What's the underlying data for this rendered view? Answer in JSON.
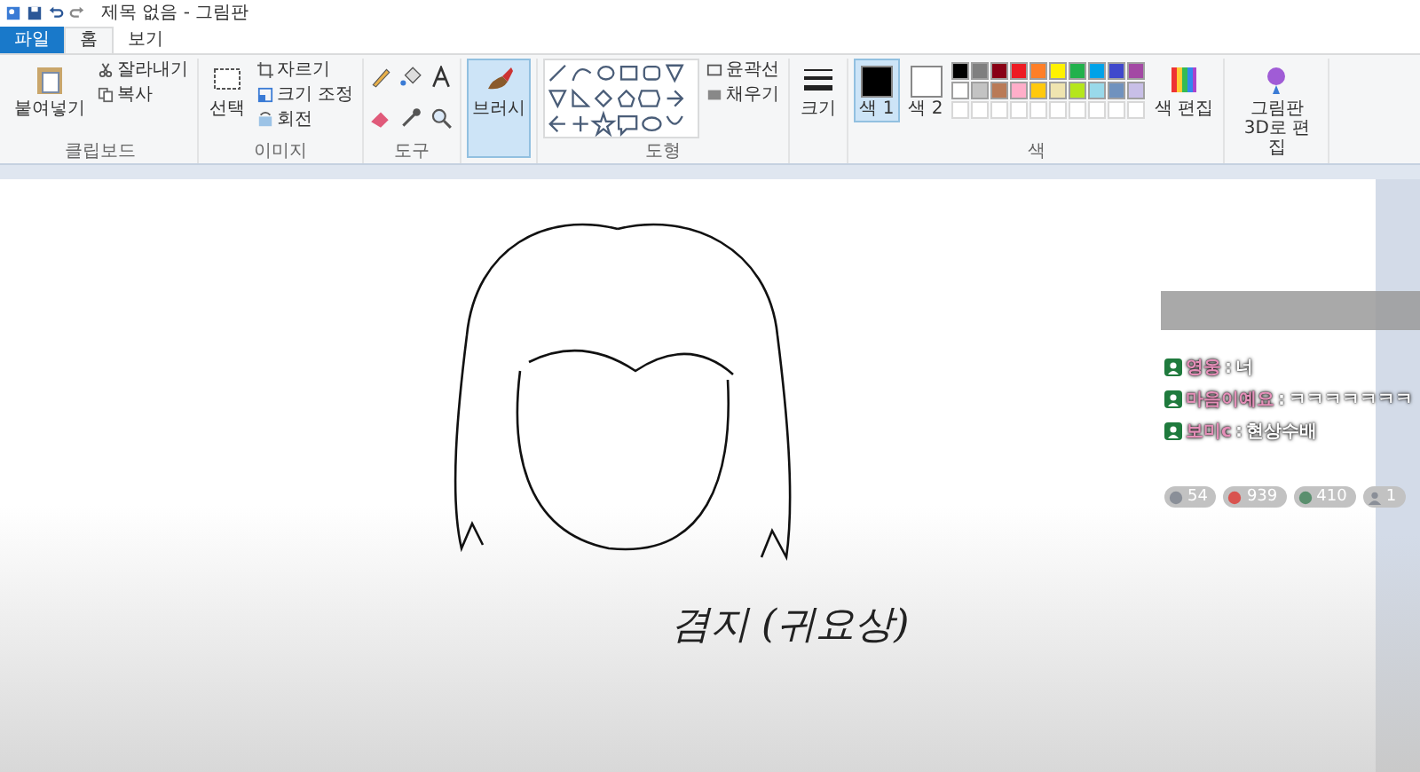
{
  "window": {
    "title": "제목 없음 - 그림판"
  },
  "tabs": [
    {
      "label": "파일",
      "kind": "file",
      "selected": false
    },
    {
      "label": "홈",
      "kind": "tab",
      "selected": true
    },
    {
      "label": "보기",
      "kind": "tab",
      "selected": false
    }
  ],
  "ribbon": {
    "clipboard": {
      "paste": "붙여넣기",
      "cut": "잘라내기",
      "copy": "복사",
      "group": "클립보드"
    },
    "image": {
      "select": "선택",
      "crop": "자르기",
      "resize": "크기 조정",
      "rotate": "회전",
      "group": "이미지"
    },
    "tools": {
      "group": "도구"
    },
    "brushes": {
      "label": "브러시"
    },
    "shapes": {
      "outline": "윤곽선",
      "fill": "채우기",
      "group": "도형"
    },
    "size": {
      "label": "크기"
    },
    "colors": {
      "group": "색",
      "primary": {
        "label": "색 1",
        "color": "#000000",
        "selected": true
      },
      "secondary": {
        "label": "색 2",
        "color": "#ffffff",
        "selected": false
      },
      "swatches": [
        {
          "color": "#000000"
        },
        {
          "color": "#7f7f7f"
        },
        {
          "color": "#880015"
        },
        {
          "color": "#ed1c24"
        },
        {
          "color": "#ff7f27"
        },
        {
          "color": "#fff200"
        },
        {
          "color": "#22b14c"
        },
        {
          "color": "#00a2e8"
        },
        {
          "color": "#3f48cc"
        },
        {
          "color": "#a349a4"
        },
        {
          "color": "#ffffff"
        },
        {
          "color": "#c3c3c3"
        },
        {
          "color": "#b97a57"
        },
        {
          "color": "#ffaec9"
        },
        {
          "color": "#ffc90e"
        },
        {
          "color": "#efe4b0"
        },
        {
          "color": "#b5e61d"
        },
        {
          "color": "#99d9ea"
        },
        {
          "color": "#7092be"
        },
        {
          "color": "#c8bfe7"
        }
      ],
      "edit": "색 편집",
      "paint3d": "그림판 3D로 편집"
    }
  },
  "canvas": {
    "caption": "겸지 (귀요상)"
  },
  "chat": {
    "messages": [
      {
        "name": "영웅",
        "separator": ":",
        "text": "너"
      },
      {
        "name": "마음이예요",
        "separator": ":",
        "text": "ㅋㅋㅋㅋㅋㅋㅋ"
      },
      {
        "name": "보미c",
        "separator": ":",
        "text": "현상수배"
      }
    ],
    "stats": [
      {
        "kind": "viewers",
        "value": "54"
      },
      {
        "kind": "likes",
        "value": "939"
      },
      {
        "kind": "points",
        "value": "410"
      },
      {
        "kind": "users",
        "value": "1"
      }
    ]
  }
}
